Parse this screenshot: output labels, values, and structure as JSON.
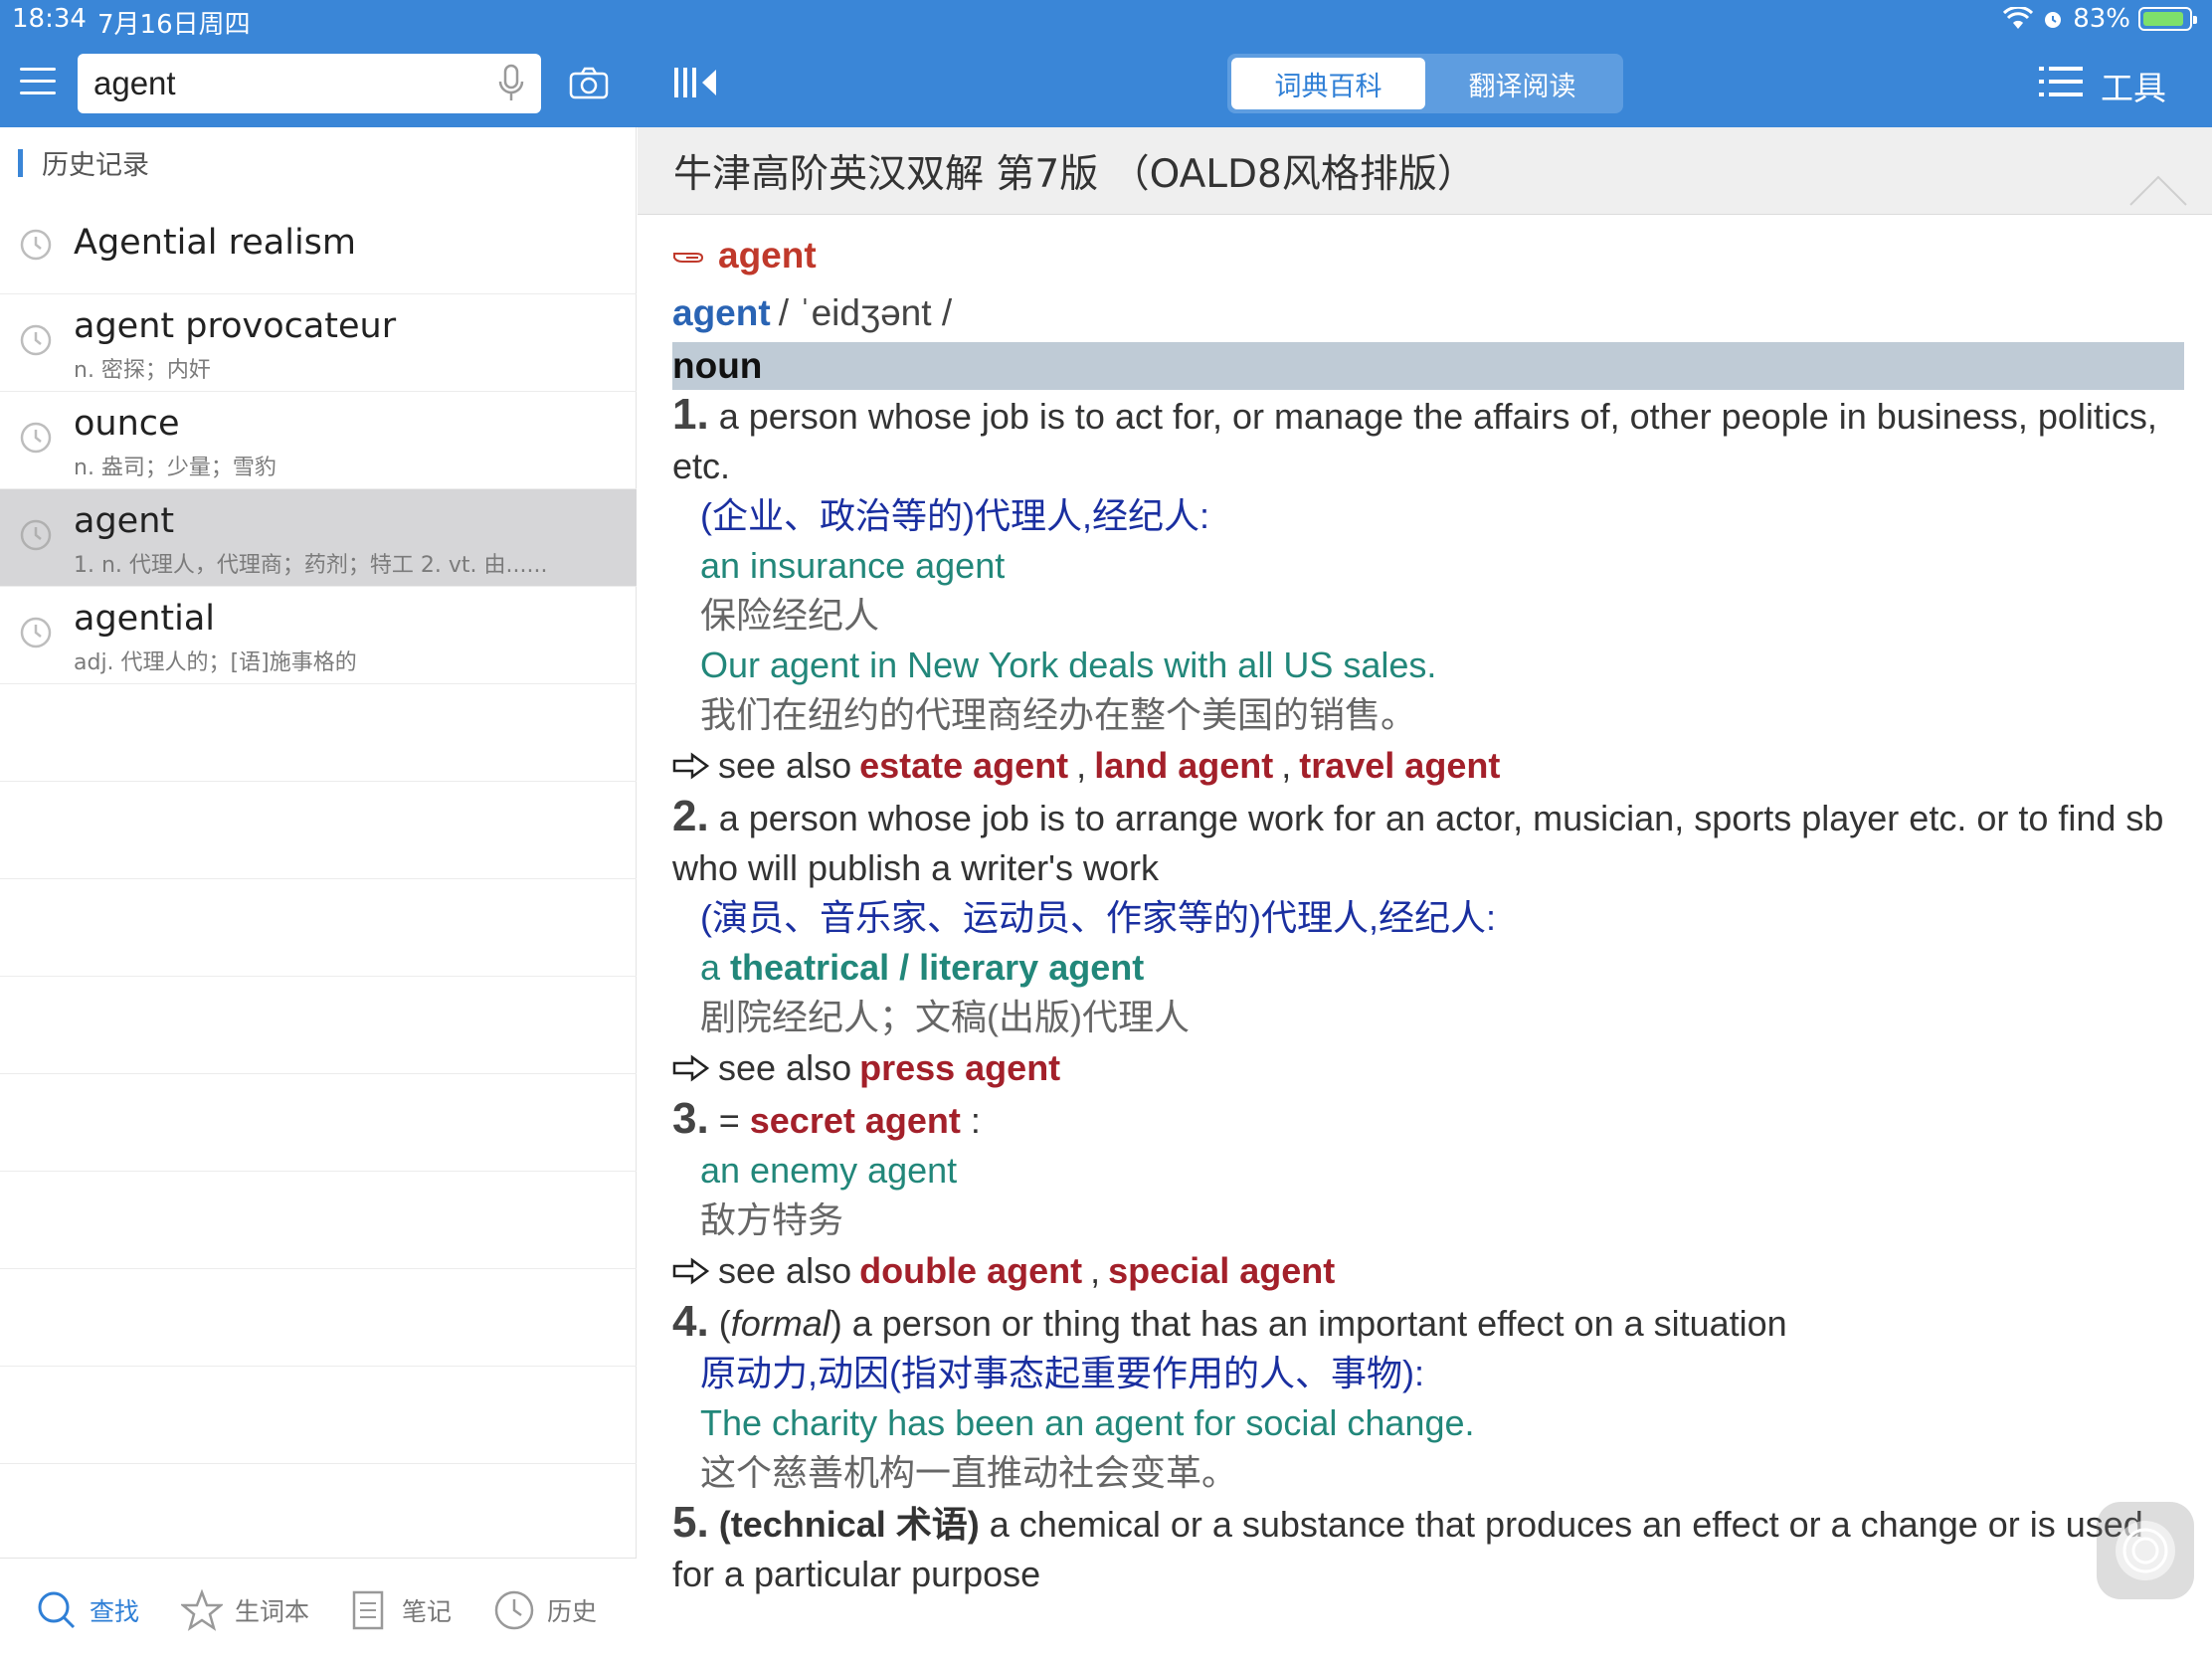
{
  "status": {
    "time": "18:34",
    "date": "7月16日周四",
    "battery": "83%"
  },
  "search": {
    "value": "agent"
  },
  "tabs": [
    {
      "label": "词典百科"
    },
    {
      "label": "翻译阅读"
    }
  ],
  "toolbar": {
    "tools_label": "工具"
  },
  "sidebar": {
    "header": "历史记录",
    "history": [
      {
        "word": "Agential realism",
        "def": ""
      },
      {
        "word": "agent provocateur",
        "def": "n. 密探；内奸"
      },
      {
        "word": "ounce",
        "def": "n. 盎司；少量；雪豹"
      },
      {
        "word": "agent",
        "def": "1. n. 代理人，代理商；药剂；特工 2. vt. 由......"
      },
      {
        "word": "agential",
        "def": "adj. 代理人的；[语]施事格的"
      }
    ]
  },
  "bottom_nav": [
    {
      "label": "查找"
    },
    {
      "label": "生词本"
    },
    {
      "label": "笔记"
    },
    {
      "label": "历史"
    }
  ],
  "dictionary": {
    "title": "牛津高阶英汉双解 第7版 （OALD8风格排版）",
    "headword": "agent",
    "pron_word": "agent",
    "pron": "/ ˈeidʒənt /",
    "pos": "noun",
    "senses": {
      "s1": {
        "num": "1.",
        "def": "a person whose job is to act for, or manage the affairs of, other people in business, politics, etc.",
        "zh": "(企业、政治等的)代理人,经纪人:",
        "ex1_en": "an insurance agent",
        "ex1_zh": "保险经纪人",
        "ex2_en": "Our agent in New York deals with all US sales.",
        "ex2_zh": "我们在纽约的代理商经办在整个美国的销售。",
        "see_also": "see also",
        "refs": [
          "estate agent",
          "land agent",
          "travel agent"
        ]
      },
      "s2": {
        "num": "2.",
        "def": "a person whose job is to arrange work for an actor, musician, sports player etc. or to find sb who will publish a writer's work",
        "zh": "(演员、音乐家、运动员、作家等的)代理人,经纪人:",
        "ex1_a": "a",
        "ex1_b": "theatrical / literary agent",
        "ex1_zh": "剧院经纪人；文稿(出版)代理人",
        "see_also": "see also",
        "refs": [
          "press agent"
        ]
      },
      "s3": {
        "num": "3.",
        "eq": "=",
        "ref": "secret agent",
        "colon": ":",
        "ex1_en": "an enemy agent",
        "ex1_zh": "敌方特务",
        "see_also": "see also",
        "refs": [
          "double agent",
          "special agent"
        ]
      },
      "s4": {
        "num": "4.",
        "formal": "formal",
        "def": "a person or thing that has an important effect on a situation",
        "zh": "原动力,动因(指对事态起重要作用的人、事物):",
        "ex1_en": "The charity has been an agent for social change.",
        "ex1_zh": "这个慈善机构一直推动社会变革。"
      },
      "s5": {
        "num": "5.",
        "tech": "(technical 术语)",
        "def": "a chemical or a substance that produces an effect or a change or is used for a particular purpose"
      }
    }
  },
  "colors": {
    "accent": "#3a86d7",
    "xref": "#a3202a",
    "example": "#22877a",
    "zh_def": "#1a2fa0"
  }
}
